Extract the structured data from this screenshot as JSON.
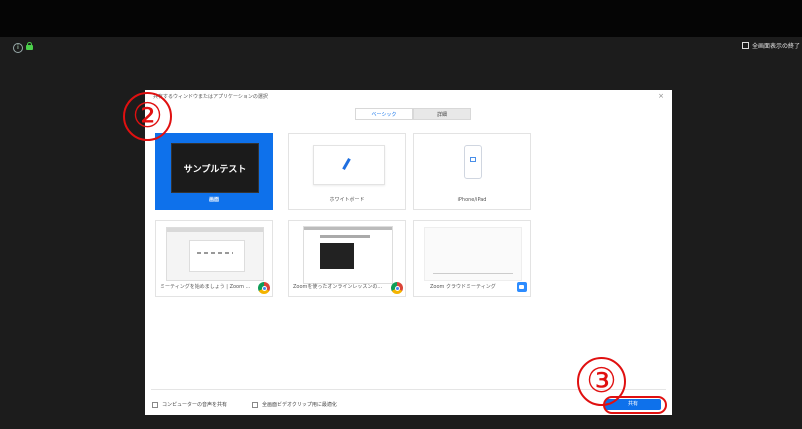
{
  "top": {
    "fullscreen_exit_label": "全画面表示の終了"
  },
  "dialog": {
    "title": "共有するウィンドウまたはアプリケーションの選択",
    "close": "×",
    "tabs": [
      {
        "label": "ベーシック"
      },
      {
        "label": "詳細"
      }
    ],
    "tiles": [
      {
        "label": "画面",
        "thumb_text": "サンプルテスト",
        "selected": true
      },
      {
        "label": "ホワイトボード"
      },
      {
        "label": "iPhone/iPad"
      },
      {
        "label": "ミーティングを始めましょう | Zoom ..."
      },
      {
        "label": "Zoomを使ったオンラインレッスンの..."
      },
      {
        "label": "Zoom クラウドミーティング"
      }
    ],
    "options": {
      "share_sound": "コンピューターの音声を共有",
      "optimize_video": "全画面ビデオクリップ用に最適化"
    },
    "share_button": "共有"
  },
  "annotations": {
    "callout_2": "②",
    "callout_3": "③"
  },
  "colors": {
    "accent": "#0e71eb",
    "annotation": "#e01010"
  }
}
